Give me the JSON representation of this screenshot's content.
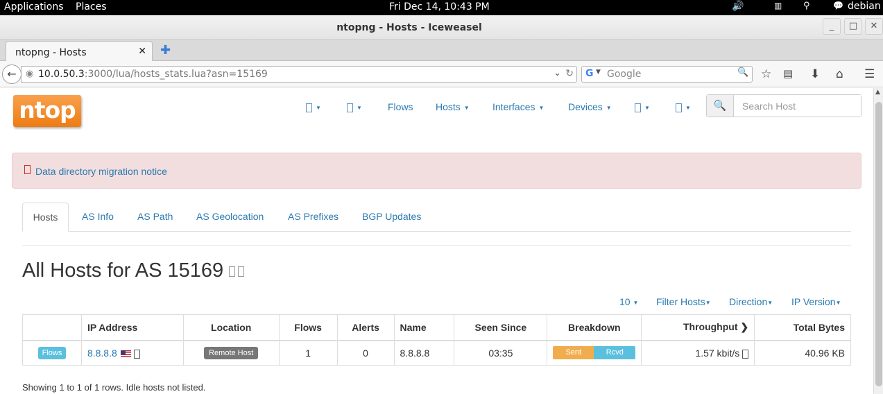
{
  "system_bar": {
    "applications": "Applications",
    "places": "Places",
    "clock": "Fri Dec 14, 10:43 PM",
    "user": "debian"
  },
  "window": {
    "title": "ntopng - Hosts - Iceweasel"
  },
  "browser": {
    "tab_title": "ntopng - Hosts",
    "url_host": "10.0.50.3",
    "url_path": ":3000/lua/hosts_stats.lua?asn=15169",
    "search_placeholder": "Google"
  },
  "app": {
    "logo": "ntop",
    "nav": {
      "flows": "Flows",
      "hosts": "Hosts",
      "interfaces": "Interfaces",
      "devices": "Devices"
    },
    "search_placeholder": "Search Host",
    "alert": "Data directory migration notice",
    "tabs": [
      "Hosts",
      "AS Info",
      "AS Path",
      "AS Geolocation",
      "AS Prefixes",
      "BGP Updates"
    ],
    "heading": "All Hosts for AS 15169",
    "toolbar": {
      "page_size": "10",
      "filter": "Filter Hosts",
      "direction": "Direction",
      "ip_version": "IP Version"
    },
    "table": {
      "headers": [
        "",
        "IP Address",
        "Location",
        "Flows",
        "Alerts",
        "Name",
        "Seen Since",
        "Breakdown",
        "Throughput",
        "Total Bytes"
      ],
      "rows": [
        {
          "action": "Flows",
          "ip": "8.8.8.8",
          "location": "Remote Host",
          "flows": "1",
          "alerts": "0",
          "name": "8.8.8.8",
          "seen_since": "03:35",
          "sent_label": "Sent",
          "rcvd_label": "Rcvd",
          "throughput": "1.57 kbit/s",
          "total_bytes": "40.96 KB"
        }
      ]
    },
    "footer": "Showing 1 to 1 of 1 rows. Idle hosts not listed."
  },
  "colors": {
    "logo_orange": "#ee7c14",
    "link_blue": "#2a7ab0",
    "alert_bg": "#f2dede",
    "sent_orange": "#f0ad4e",
    "rcvd_blue": "#5bc0de"
  }
}
